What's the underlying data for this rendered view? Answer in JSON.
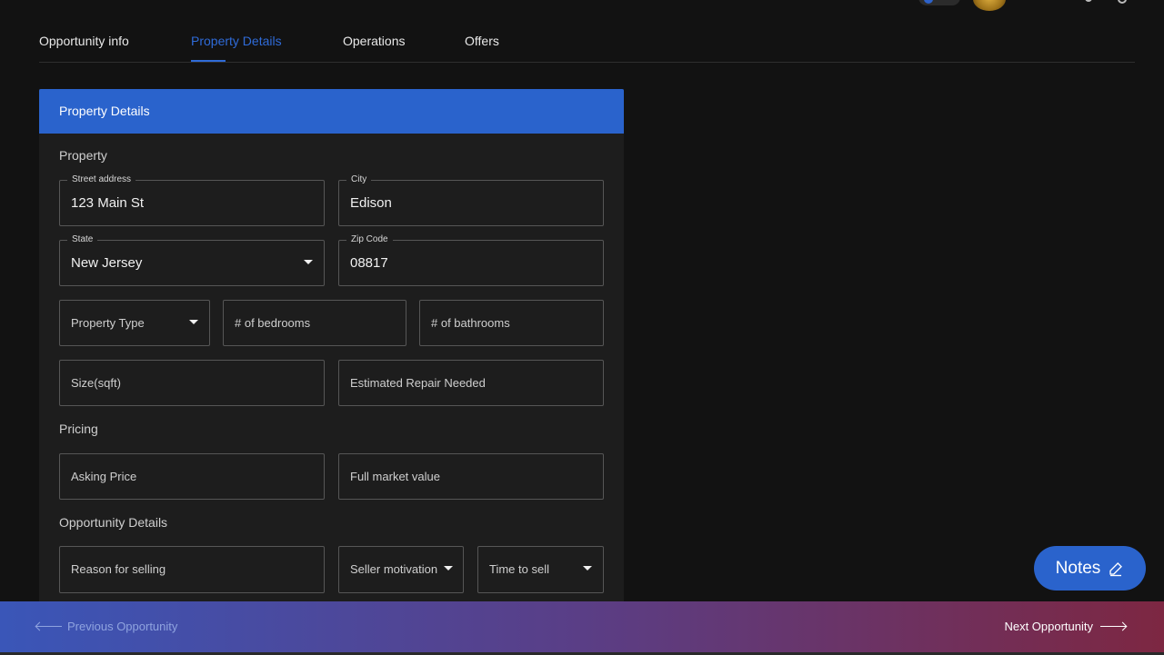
{
  "tabs": [
    {
      "label": "Opportunity info"
    },
    {
      "label": "Property Details",
      "active": true
    },
    {
      "label": "Operations"
    },
    {
      "label": "Offers"
    }
  ],
  "card": {
    "title": "Property Details",
    "sections": {
      "property": "Property",
      "pricing": "Pricing",
      "opportunity": "Opportunity Details"
    }
  },
  "fields": {
    "street": {
      "label": "Street address",
      "value": "123 Main St"
    },
    "city": {
      "label": "City",
      "value": "Edison"
    },
    "state": {
      "label": "State",
      "value": "New Jersey"
    },
    "zip": {
      "label": "Zip Code",
      "value": "08817"
    },
    "property_type": {
      "placeholder": "Property Type"
    },
    "bedrooms": {
      "placeholder": "# of bedrooms"
    },
    "bathrooms": {
      "placeholder": "# of bathrooms"
    },
    "size": {
      "placeholder": "Size(sqft)"
    },
    "repair": {
      "placeholder": "Estimated Repair Needed"
    },
    "asking_price": {
      "placeholder": "Asking Price"
    },
    "market_value": {
      "placeholder": "Full market value"
    },
    "reason": {
      "placeholder": "Reason for selling"
    },
    "motivation": {
      "placeholder": "Seller motivation"
    },
    "time_to_sell": {
      "placeholder": "Time to sell"
    }
  },
  "notes_button": {
    "label": "Notes",
    "icon": "pencil-icon"
  },
  "footer": {
    "previous": "Previous Opportunity",
    "next": "Next Opportunity"
  },
  "colors": {
    "accent": "#2a63cc",
    "background": "#121212",
    "card": "#1d1d1d"
  }
}
